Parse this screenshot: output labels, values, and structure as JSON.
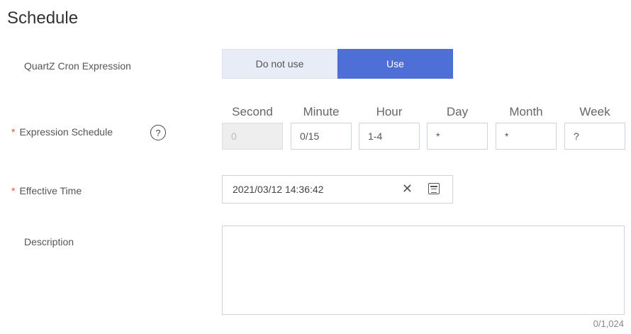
{
  "section": {
    "title": "Schedule"
  },
  "form": {
    "quartz_label": "QuartZ Cron Expression",
    "toggle": {
      "off_label": "Do not use",
      "on_label": "Use",
      "selected": "Use"
    },
    "expression": {
      "label": "Expression Schedule",
      "required_mark": "*",
      "help_icon": "question-circle-icon",
      "columns": [
        {
          "header": "Second",
          "value": "0",
          "disabled": true
        },
        {
          "header": "Minute",
          "value": "0/15",
          "disabled": false
        },
        {
          "header": "Hour",
          "value": "1-4",
          "disabled": false
        },
        {
          "header": "Day",
          "value": "*",
          "disabled": false
        },
        {
          "header": "Month",
          "value": "*",
          "disabled": false
        },
        {
          "header": "Week",
          "value": "?",
          "disabled": false
        }
      ]
    },
    "effective_time": {
      "label": "Effective Time",
      "required_mark": "*",
      "value": "2021/03/12 14:36:42",
      "clear_glyph": "✕",
      "calendar_icon": "calendar-icon"
    },
    "description": {
      "label": "Description",
      "value": "",
      "counter": "0/1,024"
    }
  },
  "colors": {
    "accent": "#4d6fd6",
    "toggle_off_bg": "#e8ecf7",
    "required": "#e0544c"
  }
}
